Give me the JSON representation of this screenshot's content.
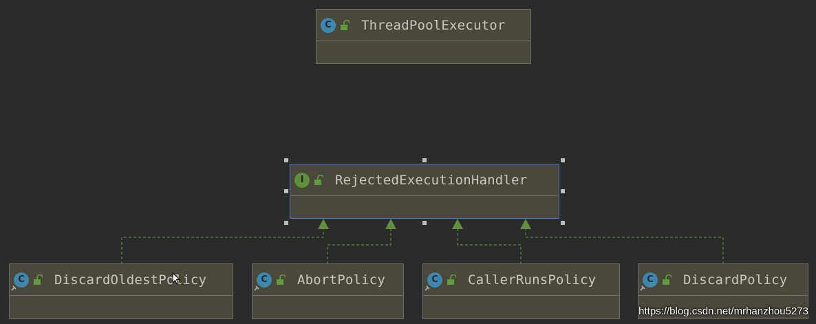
{
  "nodes": {
    "thread_pool_executor": {
      "name": "ThreadPoolExecutor",
      "kind": "class",
      "badge": "C"
    },
    "rejected_execution_handler": {
      "name": "RejectedExecutionHandler",
      "kind": "interface",
      "badge": "I"
    },
    "discard_oldest_policy": {
      "name": "DiscardOldestPolicy",
      "kind": "class",
      "badge": "C"
    },
    "abort_policy": {
      "name": "AbortPolicy",
      "kind": "class",
      "badge": "C"
    },
    "caller_runs_policy": {
      "name": "CallerRunsPolicy",
      "kind": "class",
      "badge": "C"
    },
    "discard_policy": {
      "name": "DiscardPolicy",
      "kind": "class",
      "badge": "C"
    }
  },
  "edges": [
    {
      "from": "DiscardOldestPolicy",
      "to": "RejectedExecutionHandler",
      "type": "implements"
    },
    {
      "from": "AbortPolicy",
      "to": "RejectedExecutionHandler",
      "type": "implements"
    },
    {
      "from": "CallerRunsPolicy",
      "to": "RejectedExecutionHandler",
      "type": "implements"
    },
    {
      "from": "DiscardPolicy",
      "to": "RejectedExecutionHandler",
      "type": "implements"
    }
  ],
  "colors": {
    "background": "#2b2b2b",
    "node_fill": "#4a473b",
    "class_badge": "#3f88ad",
    "interface_badge": "#5f8e3c",
    "edge": "#5f8e3c",
    "selection": "#4d74c9"
  },
  "watermark": "https://blog.csdn.net/mrhanzhou5273"
}
